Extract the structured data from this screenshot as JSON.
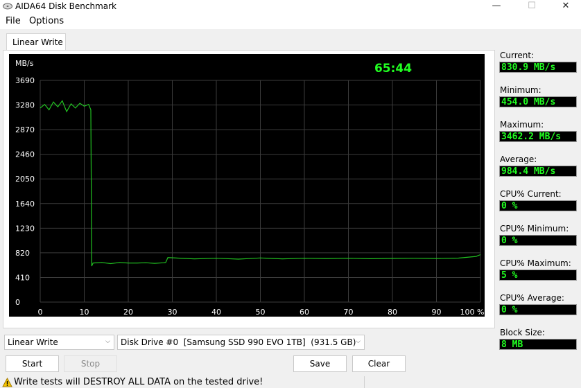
{
  "window": {
    "title": "AIDA64 Disk Benchmark",
    "minimize_glyph": "—",
    "maximize_glyph": "☐",
    "close_glyph": "✕"
  },
  "menu": [
    "File",
    "Options"
  ],
  "tab": {
    "label": "Linear Write"
  },
  "graph": {
    "unit_label": "MB/s",
    "timer": "65:44",
    "timer_color": "#21ff21",
    "line_color": "#21c021"
  },
  "chart_data": {
    "type": "line",
    "ylabel": "MB/s",
    "y_ticks": [
      0,
      410,
      820,
      1230,
      1640,
      2050,
      2460,
      2870,
      3280,
      3690
    ],
    "ylim": [
      0,
      4100
    ],
    "x_ticks": [
      "0",
      "10",
      "20",
      "30",
      "40",
      "50",
      "60",
      "70",
      "80",
      "90",
      "100 %"
    ],
    "xlim": [
      0,
      100
    ],
    "grid": true,
    "series": [
      {
        "x": [
          0,
          1,
          2,
          3,
          4,
          5,
          6,
          7,
          8,
          9,
          10,
          11,
          11.5,
          11.7,
          12,
          14,
          16,
          18,
          20,
          22,
          24,
          26,
          28,
          28.5,
          29,
          35,
          40,
          45,
          50,
          55,
          60,
          65,
          70,
          75,
          80,
          85,
          90,
          95,
          99,
          100
        ],
        "y": [
          3230,
          3290,
          3200,
          3330,
          3250,
          3350,
          3170,
          3300,
          3230,
          3310,
          3260,
          3290,
          3200,
          600,
          650,
          660,
          640,
          660,
          650,
          650,
          655,
          645,
          655,
          660,
          740,
          720,
          730,
          715,
          735,
          720,
          730,
          725,
          730,
          722,
          728,
          730,
          726,
          732,
          760,
          790
        ]
      }
    ]
  },
  "stats": [
    {
      "label": "Current:",
      "value": "830.9 MB/s"
    },
    {
      "label": "Minimum:",
      "value": "454.0 MB/s"
    },
    {
      "label": "Maximum:",
      "value": "3462.2 MB/s"
    },
    {
      "label": "Average:",
      "value": "984.4 MB/s"
    },
    {
      "label": "CPU% Current:",
      "value": "0 %"
    },
    {
      "label": "CPU% Minimum:",
      "value": "0 %"
    },
    {
      "label": "CPU% Maximum:",
      "value": "5 %"
    },
    {
      "label": "CPU% Average:",
      "value": "0 %"
    },
    {
      "label": "Block Size:",
      "value": "8 MB"
    }
  ],
  "controls": {
    "test_select": "Linear Write",
    "drive_select": "Disk Drive #0  [Samsung SSD 990 EVO 1TB]  (931.5 GB)",
    "start_label": "Start",
    "stop_label": "Stop",
    "save_label": "Save",
    "clear_label": "Clear"
  },
  "status": {
    "warning": "Write tests will DESTROY ALL DATA on the tested drive!"
  }
}
